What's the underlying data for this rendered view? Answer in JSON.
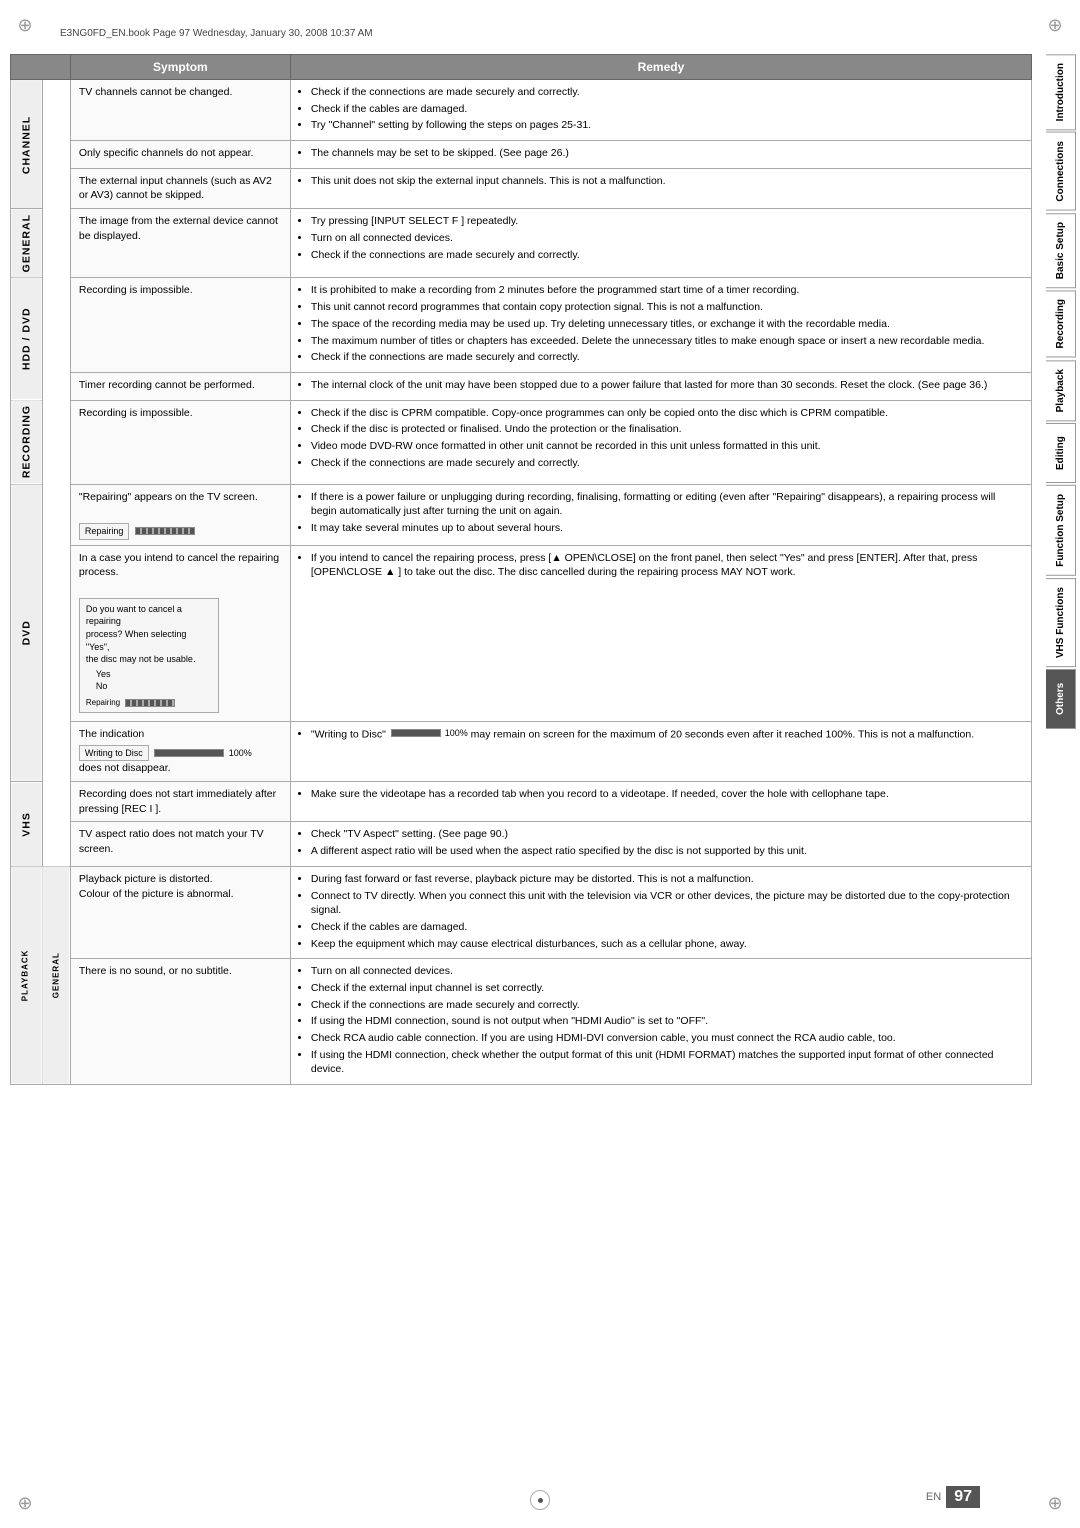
{
  "page": {
    "header_text": "E3NG0FD_EN.book  Page 97  Wednesday, January 30, 2008  10:37 AM",
    "page_number": "97",
    "page_en_label": "EN",
    "footer_page": "EN 97"
  },
  "table": {
    "col_symptom": "Symptom",
    "col_remedy": "Remedy",
    "sections": [
      {
        "label": "CHANNEL",
        "rows": [
          {
            "symptom": "TV channels cannot be changed.",
            "remedy_items": [
              "Check if the connections are made securely and correctly.",
              "Check if the cables are damaged.",
              "Try \"Channel\" setting by following the steps on pages 25-31."
            ]
          },
          {
            "symptom": "Only specific channels do not appear.",
            "remedy_items": [
              "The channels may be set to be skipped. (See page 26.)"
            ]
          },
          {
            "symptom": "The external input channels (such as AV2 or AV3) cannot be skipped.",
            "remedy_items": [
              "This unit does not skip the external input channels. This is not a malfunction."
            ]
          }
        ]
      },
      {
        "label": "GENERAL",
        "rows": [
          {
            "symptom": "The image from the external device cannot be displayed.",
            "remedy_items": [
              "Try pressing [INPUT SELECT F  ] repeatedly.",
              "Turn on all connected devices.",
              "Check if the connections are made securely and correctly."
            ]
          }
        ]
      },
      {
        "label": "HDD / DVD",
        "rows": [
          {
            "symptom": "Recording is impossible.",
            "remedy_items": [
              "It is prohibited to make a recording from 2 minutes before the programmed start time of a timer recording.",
              "This unit cannot record programmes that contain copy protection signal. This is not a malfunction.",
              "The space of the recording media may be used up. Try deleting unnecessary titles, or exchange it with the recordable media.",
              "The maximum number of titles or chapters has exceeded. Delete the unnecessary titles to make enough space or insert a new recordable media.",
              "Check if the connections are made securely and correctly."
            ]
          },
          {
            "symptom": "Timer recording cannot be performed.",
            "remedy_items": [
              "The internal clock of the unit may have been stopped due to a power failure that lasted for more than 30 seconds. Reset the clock. (See page 36.)"
            ]
          }
        ]
      },
      {
        "label": "RECORDING",
        "rows": [
          {
            "symptom": "Recording is impossible.",
            "remedy_items": [
              "Check if the disc is CPRM compatible. Copy-once programmes can only be copied onto the disc which is CPRM compatible.",
              "Check if the disc is protected or finalised. Undo the protection or the finalisation.",
              "Video mode DVD-RW once formatted in other unit cannot be recorded in this unit unless formatted in this unit.",
              "Check if the connections are made securely and correctly."
            ]
          }
        ]
      },
      {
        "label": "DVD",
        "rows": [
          {
            "symptom": "\"Repairing\" appears on the TV screen.",
            "symptom_extra": "Repairing",
            "remedy_items": [
              "If there is a power failure or unplugging during recording, finalising, formatting or editing (even after \"Repairing\" disappears), a repairing process will begin automatically just after turning the unit on again.",
              "It may take several minutes up to about several hours."
            ]
          },
          {
            "symptom": "In a case you intend to cancel the repairing process.",
            "symptom_screen": {
              "line1": "Do you want to cancel a repairing",
              "line2": "process? When selecting \"Yes\",",
              "line3": "the disc may not be usable.",
              "yes": "Yes",
              "no": "No",
              "label": "Repairing"
            },
            "remedy_items": [
              "If you intend to cancel the repairing process, press [▲ OPEN\\CLOSE] on the front panel, then select \"Yes\" and press [ENTER]. After that, press [OPEN\\CLOSE ▲ ] to take out the disc. The disc cancelled during the repairing process MAY NOT work."
            ]
          },
          {
            "symptom": "The indication",
            "symptom_writing_to_disc": "Writing to Disc",
            "symptom_progress_label": "100%",
            "symptom_suffix": "does not disappear.",
            "remedy_prefix": "\"Writing to Disc\"",
            "remedy_progress": "100%",
            "remedy_text": "may remain on screen for the maximum of 20 seconds even after it reached 100%. This is not a malfunction."
          }
        ]
      },
      {
        "label": "VHS",
        "rows": [
          {
            "symptom": "Recording does not start immediately after pressing [REC I ].",
            "remedy_items": [
              "Make sure the videotape has a recorded tab when you record to a videotape. If needed, cover the hole with cellophane tape."
            ]
          },
          {
            "symptom": "TV aspect ratio does not match your TV screen.",
            "remedy_items": [
              "Check \"TV Aspect\" setting. (See page 90.)",
              "A different aspect ratio will be used when the aspect ratio specified by the disc is not supported by this unit."
            ]
          }
        ]
      },
      {
        "label": "PLAYBACK",
        "sublabel": "GENERAL",
        "rows": [
          {
            "symptom": "Playback picture is distorted.\nColour of the picture is abnormal.",
            "remedy_items": [
              "During fast forward or fast reverse, playback picture may be distorted. This is not a malfunction.",
              "Connect to TV directly. When you connect this unit with the television via VCR or other devices, the picture may be distorted due to the copy-protection signal.",
              "Check if the cables are damaged.",
              "Keep the equipment which may cause electrical disturbances, such as a cellular phone, away."
            ]
          },
          {
            "symptom": "There is no sound, or no subtitle.",
            "remedy_items": [
              "Turn on all connected devices.",
              "Check if the external input channel is set correctly.",
              "Check if the connections are made securely and correctly.",
              "If using the HDMI connection, sound is not output when \"HDMI Audio\" is set to \"OFF\".",
              "Check RCA audio cable connection. If you are using HDMI-DVI conversion cable, you must connect the RCA audio cable, too.",
              "If using the HDMI connection, check whether the output format of this unit (HDMI FORMAT) matches the supported input format of other connected device."
            ]
          }
        ]
      }
    ]
  },
  "sidebar": {
    "tabs": [
      {
        "label": "Introduction",
        "active": false
      },
      {
        "label": "Connections",
        "active": false
      },
      {
        "label": "Basic Setup",
        "active": false
      },
      {
        "label": "Recording",
        "active": false
      },
      {
        "label": "Playback",
        "active": false
      },
      {
        "label": "Editing",
        "active": false
      },
      {
        "label": "Function Setup",
        "active": false
      },
      {
        "label": "VHS Functions",
        "active": false
      },
      {
        "label": "Others",
        "active": true
      }
    ]
  }
}
